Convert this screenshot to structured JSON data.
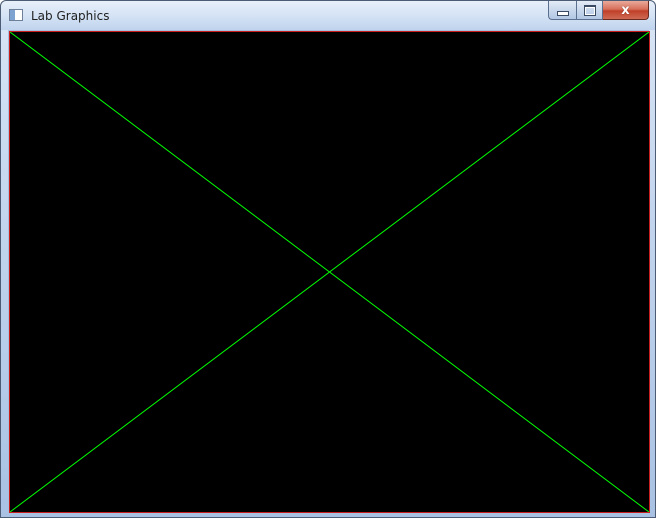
{
  "window": {
    "title": "Lab Graphics",
    "icon": "app-window-icon"
  },
  "caption_buttons": {
    "minimize": {
      "icon": "minimize-icon",
      "label": ""
    },
    "maximize": {
      "icon": "maximize-icon",
      "label": ""
    },
    "close": {
      "icon": "close-icon",
      "label": "x"
    }
  },
  "canvas": {
    "background": "#000000",
    "border_color": "#c81e1e",
    "line_color": "#00ff00",
    "lines": [
      {
        "name": "diagonal-top-left-to-bottom-right"
      },
      {
        "name": "diagonal-top-right-to-bottom-left"
      }
    ]
  }
}
